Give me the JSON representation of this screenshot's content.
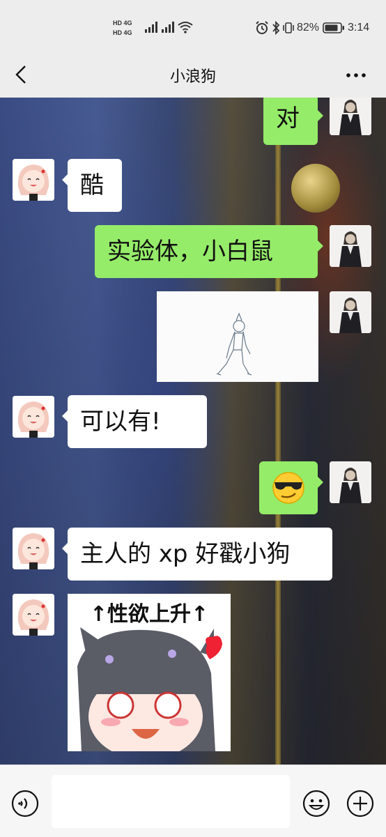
{
  "status_bar": {
    "network_1": "HD 4G",
    "network_2": "HD 4G",
    "battery": "82%",
    "time": "3:14",
    "icons": [
      "alarm-icon",
      "bluetooth-icon",
      "vibrate-icon",
      "battery-icon",
      "wifi-icon",
      "signal-icon"
    ]
  },
  "header": {
    "title": "小浪狗",
    "back_icon": "chevron-left-icon",
    "more_icon": "more-dots-icon"
  },
  "messages": [
    {
      "side": "out",
      "type": "text",
      "text": "对"
    },
    {
      "side": "in",
      "type": "text",
      "text": "酷"
    },
    {
      "side": "out",
      "type": "text",
      "text": "实验体，小白鼠"
    },
    {
      "side": "out",
      "type": "image",
      "description": "sketch-figure"
    },
    {
      "side": "in",
      "type": "text",
      "text": "可以有!"
    },
    {
      "side": "out",
      "type": "emoji",
      "text": "😏"
    },
    {
      "side": "in",
      "type": "text",
      "text": "主人的 xp 好戳小狗"
    },
    {
      "side": "in",
      "type": "sticker",
      "text": "↑性欲上升↑"
    }
  ],
  "bottom_bar": {
    "voice_icon": "voice-icon",
    "emoji_icon": "emoji-icon",
    "plus_icon": "plus-icon",
    "input_value": ""
  },
  "colors": {
    "outgoing_bubble": "#95ec69",
    "incoming_bubble": "#ffffff",
    "bar_bg": "#ededed"
  }
}
